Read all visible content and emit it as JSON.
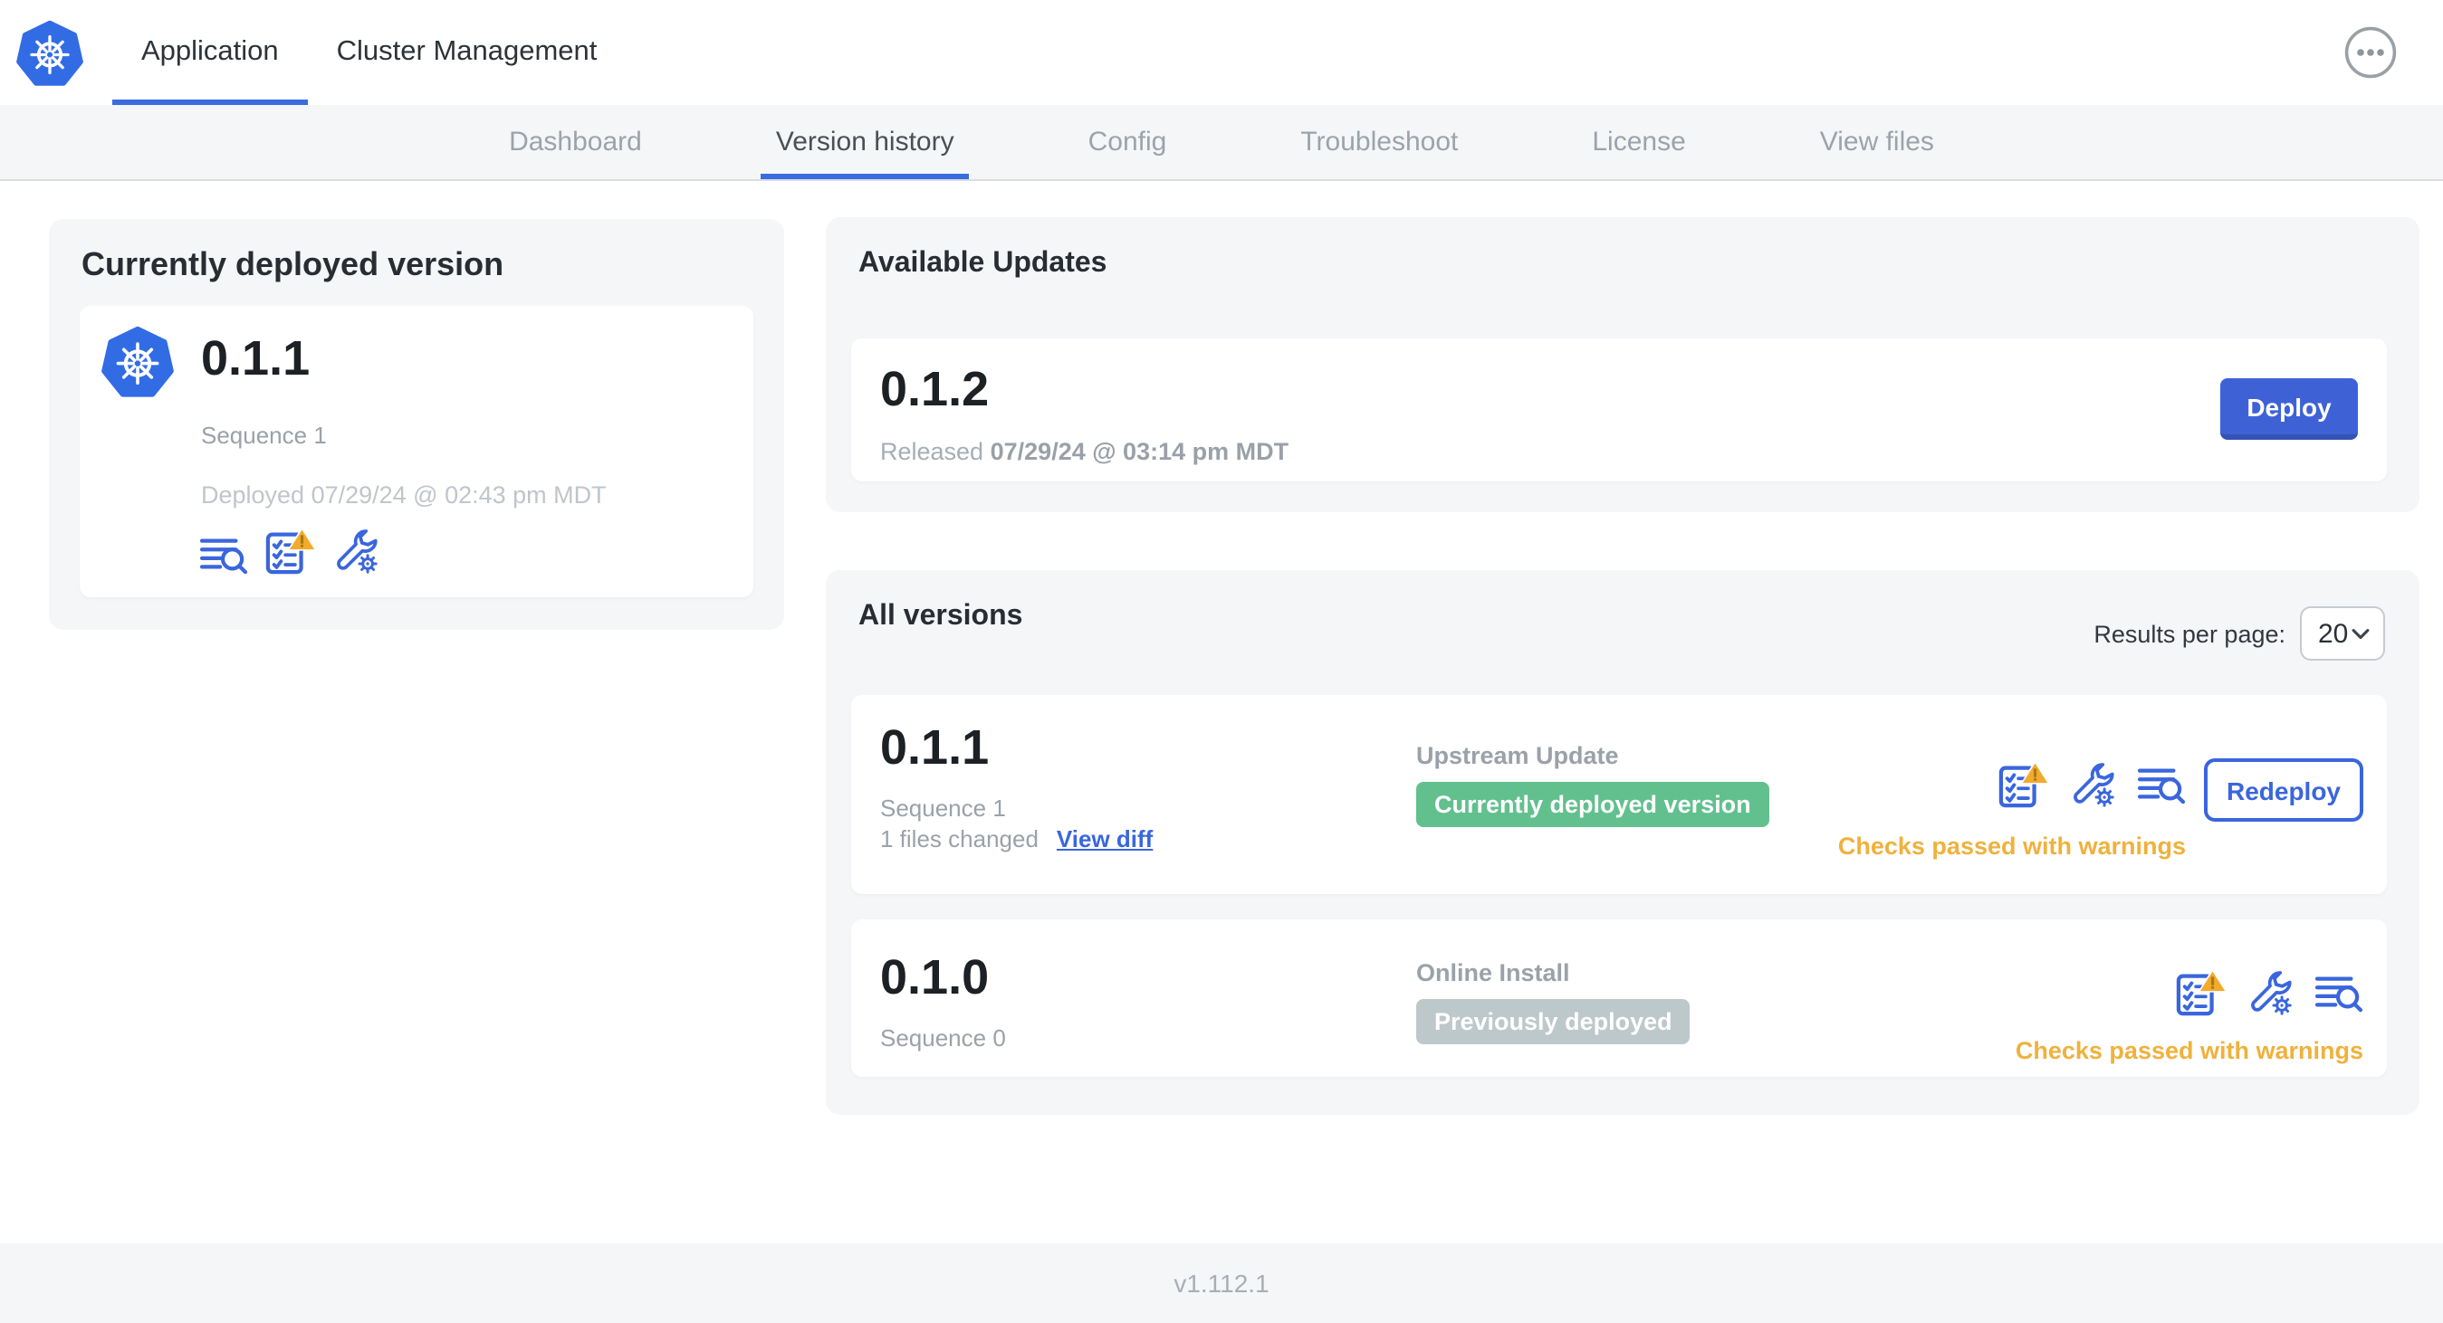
{
  "header": {
    "tabs": [
      {
        "label": "Application",
        "active": true
      },
      {
        "label": "Cluster Management",
        "active": false
      }
    ]
  },
  "nav": {
    "items": [
      "Dashboard",
      "Version history",
      "Config",
      "Troubleshoot",
      "License",
      "View files"
    ],
    "active": "Version history"
  },
  "current_version_card": {
    "title": "Currently deployed version",
    "version": "0.1.1",
    "sequence": "Sequence 1",
    "deployed_at": "Deployed 07/29/24 @ 02:43 pm MDT",
    "icons": [
      "diff-lines-magnifier",
      "preflight-checklist-warning",
      "config-wrench-gear"
    ]
  },
  "available_updates": {
    "title": "Available Updates",
    "version": "0.1.2",
    "released_label": "Released",
    "released_at": "07/29/24 @ 03:14 pm MDT",
    "deploy_button": "Deploy"
  },
  "all_versions": {
    "title": "All versions",
    "results_per_page_label": "Results per page:",
    "results_per_page": "20",
    "rows": [
      {
        "version": "0.1.1",
        "sequence": "Sequence 1",
        "files_changed": "1 files changed",
        "view_diff_label": "View diff",
        "source": "Upstream Update",
        "status_badge": "Currently deployed version",
        "badge_color": "green",
        "checks_status": "Checks passed with warnings",
        "action_label": "Redeploy",
        "icons": [
          "preflight-checklist-warning",
          "config-wrench-gear",
          "diff-lines-magnifier"
        ]
      },
      {
        "version": "0.1.0",
        "sequence": "Sequence 0",
        "source": "Online Install",
        "status_badge": "Previously deployed",
        "badge_color": "gray",
        "checks_status": "Checks passed with warnings",
        "icons": [
          "preflight-checklist-warning",
          "config-wrench-gear",
          "diff-lines-magnifier"
        ]
      }
    ]
  },
  "footer": {
    "app_version": "v1.112.1"
  },
  "icons": {
    "brand": "kubernetes-wheel",
    "menu": "ellipsis-in-circle",
    "dropdown": "chevron-down"
  },
  "colors": {
    "primary_blue": "#3a66dd",
    "deploy_button_blue": "#3e62d6",
    "kubernetes_blue": "#326ce5",
    "green_badge": "#62c08e",
    "gray_badge": "#bdc8cb",
    "warning_orange": "#f0b13c",
    "card_background": "#f5f6f8"
  }
}
